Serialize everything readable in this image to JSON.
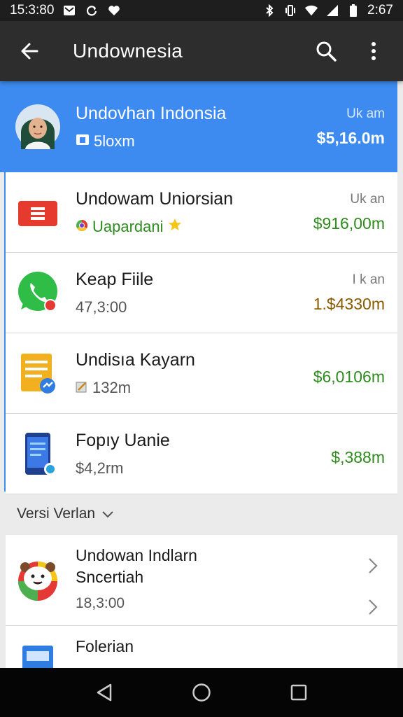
{
  "status_bar": {
    "time": "15:3:80",
    "clock_right": "2:67"
  },
  "app_bar": {
    "title": "Undownesia"
  },
  "list": [
    {
      "title": "Undovhan Indonsia",
      "subtitle": "5loxm",
      "label": "Uk am",
      "amount": "$5,16.0m",
      "icon": "profile-photo",
      "selected": true,
      "amount_color": "#ffffff"
    },
    {
      "title": "Undowam Uniorsian",
      "subtitle": "Uapardani",
      "label": "Uk an",
      "amount": "$916,00m",
      "icon": "red-document-icon",
      "selected": false,
      "amount_color": "#2e8b1e"
    },
    {
      "title": "Keap Fiile",
      "subtitle": "47,3:00",
      "label": "I k an",
      "amount": "1.$4330m",
      "icon": "whatsapp-icon",
      "selected": false,
      "amount_color": "#8b5a00"
    },
    {
      "title": "Undisıa Kayarn",
      "subtitle": "132m",
      "label": "",
      "amount": "$6,0106m",
      "icon": "yellow-notes-icon",
      "selected": false,
      "amount_color": "#2e8b1e"
    },
    {
      "title": "Fopıy Uanie",
      "subtitle": "$4,2rm",
      "label": "",
      "amount": "$,388m",
      "icon": "phone-app-icon",
      "selected": false,
      "amount_color": "#2e8b1e"
    }
  ],
  "section": {
    "label": "Versi Verlan"
  },
  "cards": [
    {
      "title_line1": "Undowan Indlarn",
      "title_line2": "Sncertiah",
      "subtitle": "18,3:00",
      "icon": "cartoon-bear-icon"
    },
    {
      "title_line1": "Folerian",
      "title_line2": "",
      "subtitle": "",
      "icon": "blue-document-icon"
    }
  ],
  "colors": {
    "accent": "#3d8bf0",
    "app_bar": "#2d2d2d",
    "amount_green": "#2e8b1e"
  }
}
